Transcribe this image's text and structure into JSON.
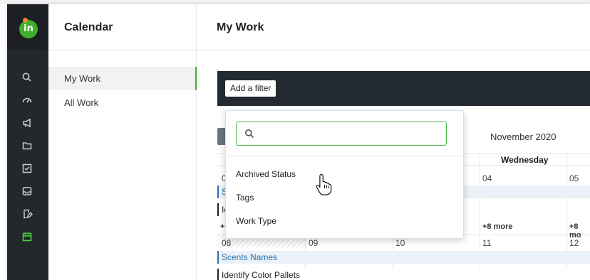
{
  "logo": {
    "text": "in"
  },
  "rail": {
    "icons": [
      "search-icon",
      "gauge-icon",
      "megaphone-icon",
      "folder-icon",
      "checkbox-icon",
      "inbox-icon",
      "document-edit-icon",
      "calendar-icon"
    ]
  },
  "sidebar": {
    "title": "Calendar",
    "items": [
      {
        "label": "My Work",
        "active": true
      },
      {
        "label": "All Work",
        "active": false
      }
    ]
  },
  "main": {
    "title": "My Work",
    "add_filter_label": "Add a filter",
    "month_title": "November 2020"
  },
  "calendar": {
    "day_headers": [
      {
        "label": "Wednesday"
      }
    ],
    "week1": {
      "dates": [
        "0",
        "04",
        "05"
      ],
      "events": [
        "Sc",
        "Id"
      ],
      "more": [
        "+",
        "+8 more",
        "+8 mo"
      ]
    },
    "week2": {
      "dates": [
        "08",
        "09",
        "10",
        "11",
        "12"
      ],
      "events": [
        "Scents Names",
        "Identify Color Pallets"
      ]
    }
  },
  "filter_dropdown": {
    "search_value": "",
    "search_placeholder": "",
    "options": [
      "Archived Status",
      "Tags",
      "Work Type"
    ]
  },
  "colors": {
    "accent": "#3fae2a",
    "rail_bg": "#23282d",
    "filter_bar_bg": "#232a31",
    "event_blue": "#2f6fa9"
  }
}
